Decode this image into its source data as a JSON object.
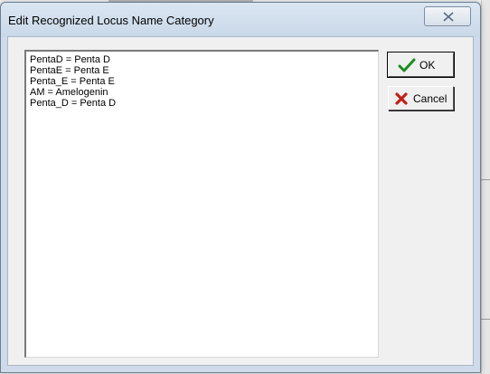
{
  "dialog": {
    "title": "Edit Recognized Locus Name Category",
    "memo_lines": [
      "PentaD = Penta D",
      "PentaE = Penta E",
      "Penta_E = Penta E",
      "AM = Amelogenin",
      "Penta_D = Penta D"
    ],
    "ok_label": "OK",
    "cancel_label": "Cancel"
  },
  "colors": {
    "ok_check": "#1e8c1e",
    "cancel_x": "#c0201a",
    "title_bar": "#cfdbea"
  },
  "icons": {
    "close": "close-icon",
    "ok": "checkmark-icon",
    "cancel": "x-icon"
  }
}
